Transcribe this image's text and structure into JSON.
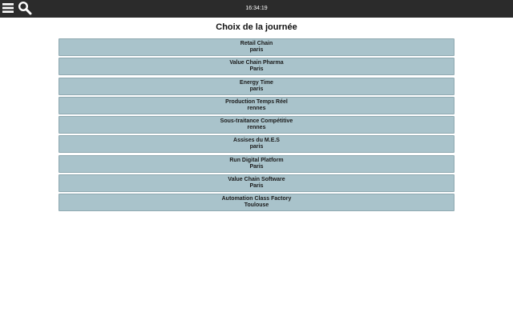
{
  "header": {
    "menu_icon": "hamburger-menu-icon",
    "search_icon": "search-icon",
    "time": "16:34:19",
    "bar_color": "#2b2b2b"
  },
  "main": {
    "title": "Choix de la journée",
    "item_color": "#a9c3cb",
    "days": [
      {
        "name": "Retail Chain",
        "city": "paris"
      },
      {
        "name": "Value Chain Pharma",
        "city": "Paris"
      },
      {
        "name": "Energy Time",
        "city": "paris"
      },
      {
        "name": "Production Temps Réel",
        "city": "rennes"
      },
      {
        "name": "Sous-traitance Compétitive",
        "city": "rennes"
      },
      {
        "name": "Assises du M.E.S",
        "city": "paris"
      },
      {
        "name": "Run Digital Platform",
        "city": "Paris"
      },
      {
        "name": "Value Chain Software",
        "city": "Paris"
      },
      {
        "name": "Automation Class Factory",
        "city": "Toulouse"
      }
    ]
  }
}
